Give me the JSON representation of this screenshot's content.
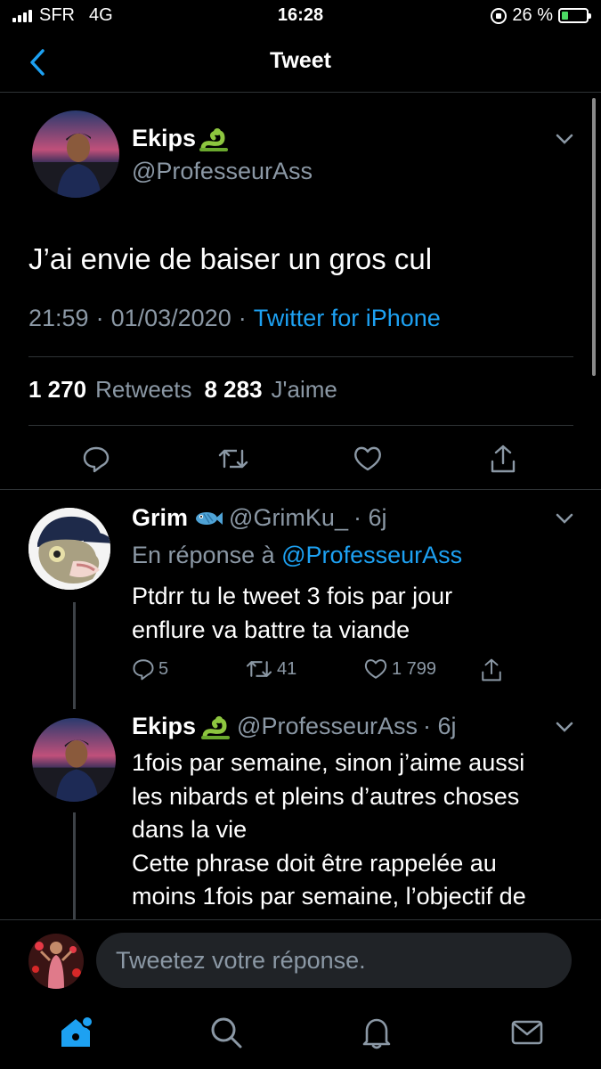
{
  "status_bar": {
    "carrier": "SFR",
    "network": "4G",
    "time": "16:28",
    "battery": "26 %",
    "battery_level": 0.26
  },
  "nav": {
    "title": "Tweet"
  },
  "main_tweet": {
    "name": "Ekips",
    "handle": "@ProfesseurAss",
    "text": "J’ai envie de baiser un gros cul",
    "time": "21:59",
    "dot": "·",
    "date": "01/03/2020",
    "dot2": "·",
    "source": "Twitter for iPhone",
    "retweets_count": "1 270",
    "retweets_label": "Retweets",
    "likes_count": "8 283",
    "likes_label": "J'aime"
  },
  "replies": [
    {
      "name": "Grim",
      "handle": "@GrimKu_",
      "age": "· 6j",
      "reply_prefix": "En réponse à",
      "reply_to": "@ProfesseurAss",
      "text_lines": [
        "Ptdrr tu le tweet 3 fois par jour",
        "enflure va battre ta viande"
      ],
      "replies_count": "5",
      "retweets_count": "41",
      "likes_count": "1 799"
    },
    {
      "name": "Ekips",
      "handle": "@ProfesseurAss",
      "age": "· 6j",
      "text_lines": [
        "1fois par semaine, sinon j’aime aussi",
        "les nibards et pleins d’autres choses",
        "dans la vie",
        "Cette phrase doit être rappelée au",
        "moins 1fois par semaine, l’objectif de"
      ]
    }
  ],
  "composer": {
    "placeholder": "Tweetez votre réponse."
  },
  "colors": {
    "accent": "#1da1f2",
    "background": "#000000",
    "secondary_text": "#8b98a5",
    "divider": "#2f3336"
  },
  "icons": {
    "back": "chevron-left-icon",
    "reply": "reply-icon",
    "retweet": "retweet-icon",
    "like": "heart-icon",
    "share": "share-icon",
    "home": "home-icon",
    "search": "search-icon",
    "notifications": "bell-icon",
    "messages": "mail-icon"
  }
}
